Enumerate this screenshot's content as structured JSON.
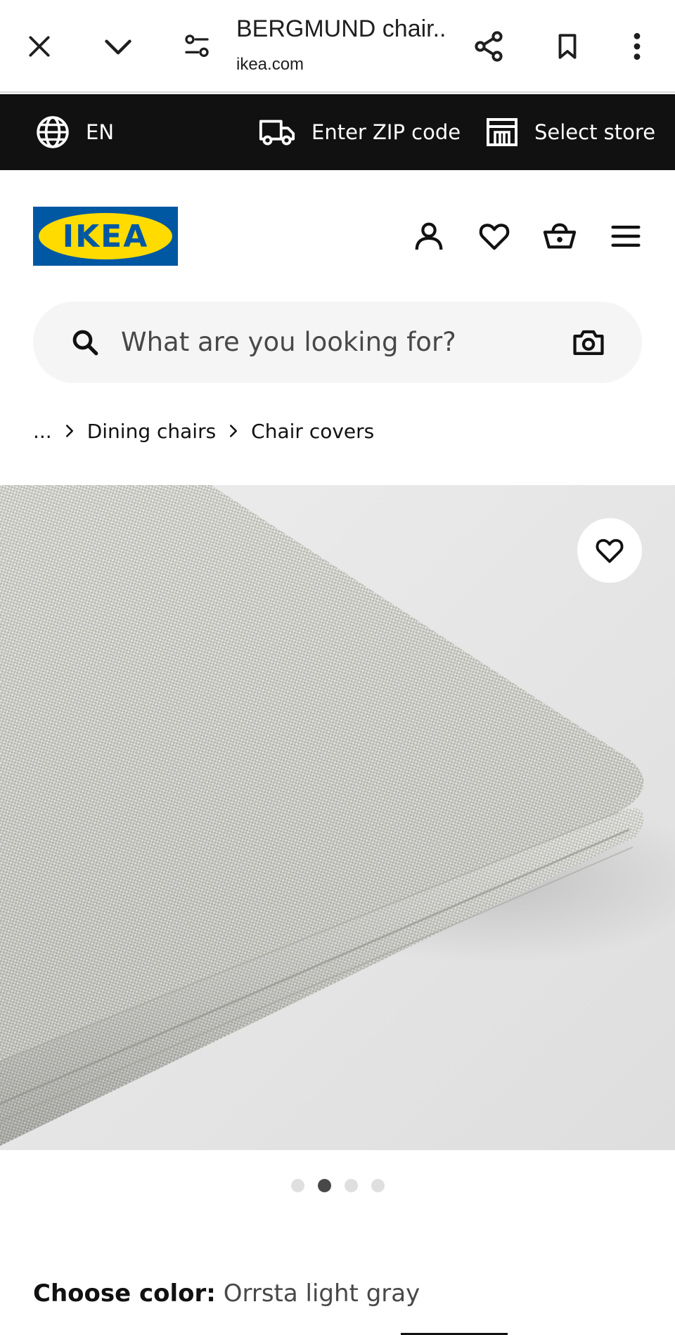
{
  "browser": {
    "title": "BERGMUND chair...",
    "url": "ikea.com"
  },
  "utility_bar": {
    "language": "EN",
    "zip_label": "Enter ZIP code",
    "store_label": "Select store"
  },
  "header": {
    "logo_text": "IKEA"
  },
  "search": {
    "placeholder": "What are you looking for?"
  },
  "breadcrumb": {
    "ellipsis": "...",
    "items": [
      "Dining chairs",
      "Chair covers"
    ]
  },
  "carousel": {
    "dot_count": 4,
    "active_index": 1
  },
  "product": {
    "color_label": "Choose color:",
    "color_value": "Orrsta light gray"
  },
  "colors": {
    "ikea_blue": "#0058a3",
    "ikea_yellow": "#ffdb00",
    "utility_bar_bg": "#111111"
  }
}
